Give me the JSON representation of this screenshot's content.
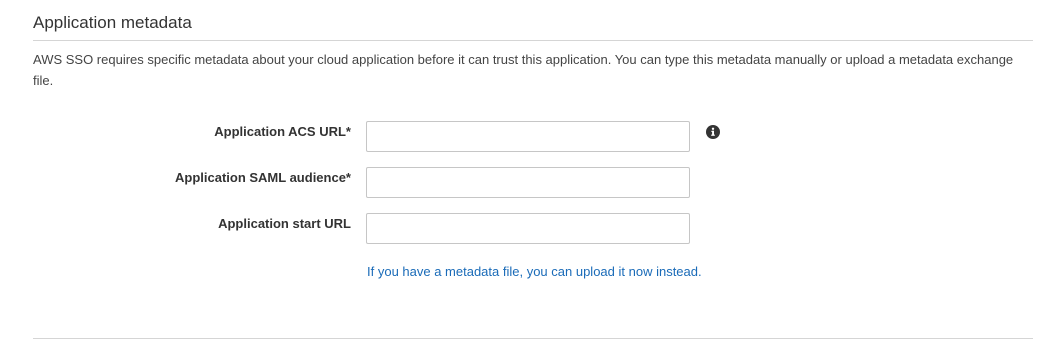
{
  "section": {
    "title": "Application metadata",
    "description": "AWS SSO requires specific metadata about your cloud application before it can trust this application. You can type this metadata manually or upload a metadata exchange file."
  },
  "fields": [
    {
      "label": "Application ACS URL*",
      "value": "",
      "has_info_icon": true
    },
    {
      "label": "Application SAML audience*",
      "value": ""
    },
    {
      "label": "Application start URL",
      "value": ""
    }
  ],
  "upload_link": "If you have a metadata file, you can upload it now instead.",
  "icons": {
    "info": "info-icon"
  },
  "colors": {
    "link": "#1a6bb8",
    "rule": "#d5d5d5",
    "input_border": "#c6c6c6",
    "icon": "#333333"
  }
}
